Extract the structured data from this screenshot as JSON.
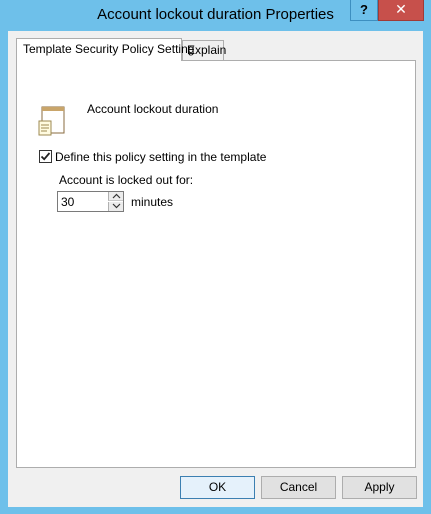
{
  "window": {
    "title": "Account lockout duration Properties",
    "help_label": "?",
    "close_label": "✕"
  },
  "tabs": [
    {
      "label": "Template Security Policy Setting",
      "active": true
    },
    {
      "label": "Explain",
      "active": false
    }
  ],
  "policy": {
    "name": "Account lockout duration",
    "icon": "policy-document-icon",
    "define_label": "Define this policy setting in the template",
    "define_checked": true,
    "locked_label": "Account is locked out for:",
    "duration_value": "30",
    "unit_label": "minutes"
  },
  "buttons": {
    "ok": "OK",
    "cancel": "Cancel",
    "apply": "Apply"
  },
  "colors": {
    "frame": "#6ec0ea",
    "close": "#c7504b"
  }
}
